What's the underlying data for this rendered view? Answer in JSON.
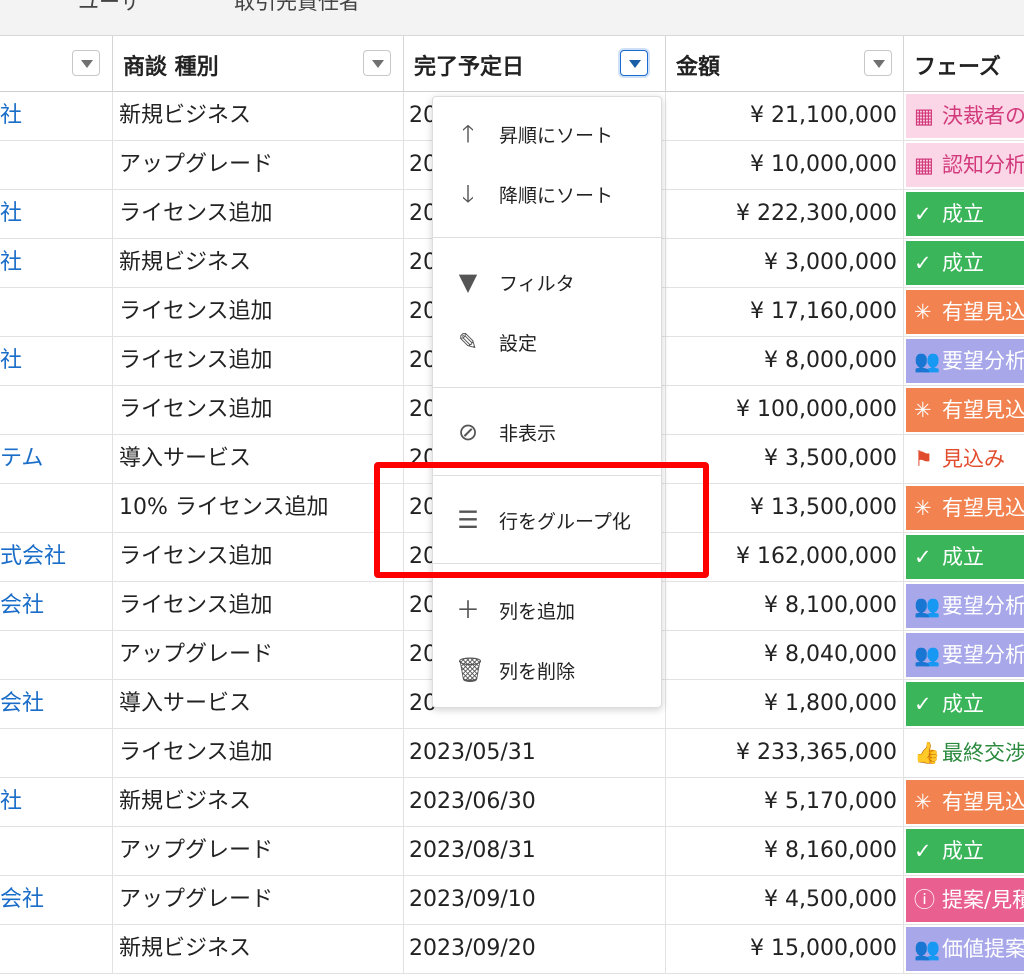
{
  "top_tabs": [
    "ユーザ",
    "取引先責任者"
  ],
  "columns": [
    {
      "label": ""
    },
    {
      "label": "商談 種別"
    },
    {
      "label": "完了予定日"
    },
    {
      "label": "金額"
    },
    {
      "label": "フェーズ"
    }
  ],
  "rows": [
    {
      "account": "社",
      "type": "新規ビジネス",
      "date": "20",
      "amount": "¥ 21,100,000",
      "phase": "決裁者の",
      "phase_color": "#fbd6e6",
      "phase_text_color": "#d23a7c",
      "phase_icon": "table-icon"
    },
    {
      "account": "",
      "type": "アップグレード",
      "date": "20",
      "amount": "¥ 10,000,000",
      "phase": "認知分析",
      "phase_color": "#fbd6e6",
      "phase_text_color": "#d23a7c",
      "phase_icon": "table-icon"
    },
    {
      "account": "社",
      "type": "ライセンス追加",
      "date": "20",
      "amount": "¥ 222,300,000",
      "phase": "成立",
      "phase_color": "#3ab55a",
      "phase_text_color": "#ffffff",
      "phase_icon": "check-icon"
    },
    {
      "account": "社",
      "type": "新規ビジネス",
      "date": "20",
      "amount": "¥ 3,000,000",
      "phase": "成立",
      "phase_color": "#3ab55a",
      "phase_text_color": "#ffffff",
      "phase_icon": "check-icon"
    },
    {
      "account": "",
      "type": "ライセンス追加",
      "date": "20",
      "amount": "¥ 17,160,000",
      "phase": "有望見込",
      "phase_color": "#f2824f",
      "phase_text_color": "#ffffff",
      "phase_icon": "sparkle-icon"
    },
    {
      "account": "社",
      "type": "ライセンス追加",
      "date": "20",
      "amount": "¥ 8,000,000",
      "phase": "要望分析",
      "phase_color": "#a7a7ea",
      "phase_text_color": "#ffffff",
      "phase_icon": "people-icon"
    },
    {
      "account": "",
      "type": "ライセンス追加",
      "date": "20",
      "amount": "¥ 100,000,000",
      "phase": "有望見込",
      "phase_color": "#f2824f",
      "phase_text_color": "#ffffff",
      "phase_icon": "sparkle-icon"
    },
    {
      "account": "テム",
      "type": "導入サービス",
      "date": "20",
      "amount": "¥ 3,500,000",
      "phase": "見込み",
      "phase_color": "#ffffff",
      "phase_text_color": "#e24c2e",
      "phase_icon": "flag-icon"
    },
    {
      "account": "",
      "type": "10% ライセンス追加",
      "date": "20",
      "amount": "¥ 13,500,000",
      "phase": "有望見込",
      "phase_color": "#f2824f",
      "phase_text_color": "#ffffff",
      "phase_icon": "sparkle-icon"
    },
    {
      "account": "式会社",
      "type": "ライセンス追加",
      "date": "20",
      "amount": "¥ 162,000,000",
      "phase": "成立",
      "phase_color": "#3ab55a",
      "phase_text_color": "#ffffff",
      "phase_icon": "check-icon"
    },
    {
      "account": "会社",
      "type": "ライセンス追加",
      "date": "20",
      "amount": "¥ 8,100,000",
      "phase": "要望分析",
      "phase_color": "#a7a7ea",
      "phase_text_color": "#ffffff",
      "phase_icon": "people-icon"
    },
    {
      "account": "",
      "type": "アップグレード",
      "date": "20",
      "amount": "¥ 8,040,000",
      "phase": "要望分析",
      "phase_color": "#a7a7ea",
      "phase_text_color": "#ffffff",
      "phase_icon": "people-icon"
    },
    {
      "account": "会社",
      "type": "導入サービス",
      "date": "20",
      "amount": "¥ 1,800,000",
      "phase": "成立",
      "phase_color": "#3ab55a",
      "phase_text_color": "#ffffff",
      "phase_icon": "check-icon"
    },
    {
      "account": "",
      "type": "ライセンス追加",
      "date": "2023/05/31",
      "amount": "¥ 233,365,000",
      "phase": "最終交渉",
      "phase_color": "#ffffff",
      "phase_text_color": "#2b8a3e",
      "phase_icon": "thumbs-up-icon"
    },
    {
      "account": "社",
      "type": "新規ビジネス",
      "date": "2023/06/30",
      "amount": "¥ 5,170,000",
      "phase": "有望見込",
      "phase_color": "#f2824f",
      "phase_text_color": "#ffffff",
      "phase_icon": "sparkle-icon"
    },
    {
      "account": "",
      "type": "アップグレード",
      "date": "2023/08/31",
      "amount": "¥ 8,160,000",
      "phase": "成立",
      "phase_color": "#3ab55a",
      "phase_text_color": "#ffffff",
      "phase_icon": "check-icon"
    },
    {
      "account": "会社",
      "type": "アップグレード",
      "date": "2023/09/10",
      "amount": "¥ 4,500,000",
      "phase": "提案/見積",
      "phase_color": "#e95f8f",
      "phase_text_color": "#ffffff",
      "phase_icon": "info-icon"
    },
    {
      "account": "",
      "type": "新規ビジネス",
      "date": "2023/09/20",
      "amount": "¥ 15,000,000",
      "phase": "価値提案",
      "phase_color": "#a7a7ea",
      "phase_text_color": "#ffffff",
      "phase_icon": "people-icon"
    }
  ],
  "column_menu": {
    "items": [
      {
        "label": "昇順にソート",
        "icon": "arrow-up-icon"
      },
      {
        "label": "降順にソート",
        "icon": "arrow-down-icon"
      },
      {
        "label": "フィルタ",
        "icon": "filter-icon"
      },
      {
        "label": "設定",
        "icon": "pencil-icon"
      },
      {
        "label": "非表示",
        "icon": "hide-icon"
      },
      {
        "label": "行をグループ化",
        "icon": "group-rows-icon"
      },
      {
        "label": "列を追加",
        "icon": "plus-icon"
      },
      {
        "label": "列を削除",
        "icon": "trash-icon"
      }
    ]
  },
  "colors": {
    "link": "#1a6dc8",
    "highlight": "#ff0000",
    "accent": "#1b6bd0"
  }
}
